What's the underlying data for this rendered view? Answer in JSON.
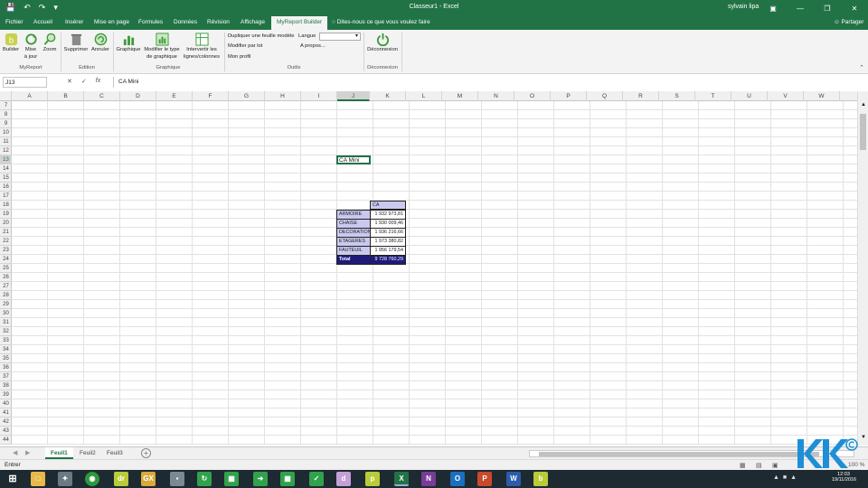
{
  "window": {
    "title": "Classeur1  -  Excel",
    "user": "sylvain lipa"
  },
  "tabs": [
    "Fichier",
    "Accueil",
    "Insérer",
    "Mise en page",
    "Formules",
    "Données",
    "Révision",
    "Affichage",
    "MyReport Builder"
  ],
  "tell_me": "Dites-nous ce que vous voulez faire",
  "share": "Partager",
  "ribbon": {
    "builder": "Builder",
    "mise_a_jour": [
      "Mise",
      "à jour"
    ],
    "zoom": "Zoom",
    "supprimer": "Supprimer",
    "annuler": "Annuler",
    "graphique": "Graphique",
    "modifier_type": [
      "Modifier le type",
      "de graphique"
    ],
    "intervertir": [
      "Intervertir les",
      "lignes/colonnes"
    ],
    "dupliquer": "Dupliquer une feuille modèle",
    "langue": "Langue",
    "modifier_lot": "Modifier par lot",
    "a_propos": "A propos...",
    "mon_profil": "Mon profil",
    "deconnexion": "Déconnexion",
    "groups": [
      "MyReport",
      "Edition",
      "Graphique",
      "Outils",
      "Déconnexion"
    ]
  },
  "formula_bar": {
    "namebox": "J13",
    "fx": "fx",
    "content": "CA Mini"
  },
  "columns": [
    "A",
    "B",
    "C",
    "D",
    "E",
    "F",
    "G",
    "H",
    "I",
    "J",
    "K",
    "L",
    "M",
    "N",
    "O",
    "P",
    "Q",
    "R",
    "S",
    "T",
    "U",
    "V",
    "W"
  ],
  "rows": [
    "7",
    "8",
    "9",
    "10",
    "11",
    "12",
    "13",
    "14",
    "15",
    "16",
    "17",
    "18",
    "19",
    "20",
    "21",
    "22",
    "23",
    "24",
    "25",
    "26",
    "27",
    "28",
    "29",
    "30",
    "31",
    "32",
    "33",
    "34",
    "35",
    "36",
    "37",
    "38",
    "39",
    "40",
    "41",
    "42",
    "43",
    "44"
  ],
  "active_cell": {
    "ref": "J13",
    "value": "CA Mini"
  },
  "table": {
    "header": "CA",
    "rows": [
      {
        "label": "ARMOIRE",
        "value": "1 932 973,81"
      },
      {
        "label": "CHAISE",
        "value": "1 930 009,46"
      },
      {
        "label": "DECORATION",
        "value": "1 936 216,66"
      },
      {
        "label": "ETAGERES",
        "value": "1 973 380,82"
      },
      {
        "label": "FAUTEUIL",
        "value": "1 956 179,54"
      }
    ],
    "total_label": "Total",
    "total_value": "9 728 760,29"
  },
  "sheets": [
    "Feuil1",
    "Feuil2",
    "Feuil3"
  ],
  "status": {
    "mode": "Entrer",
    "zoom": "100 %"
  },
  "taskbar": {
    "time": "12:03",
    "date": "19/11/2016"
  },
  "colors": {
    "excel_green": "#217346",
    "table_label_bg": "#c9c9f0",
    "table_total_bg": "#1f1a7a"
  }
}
